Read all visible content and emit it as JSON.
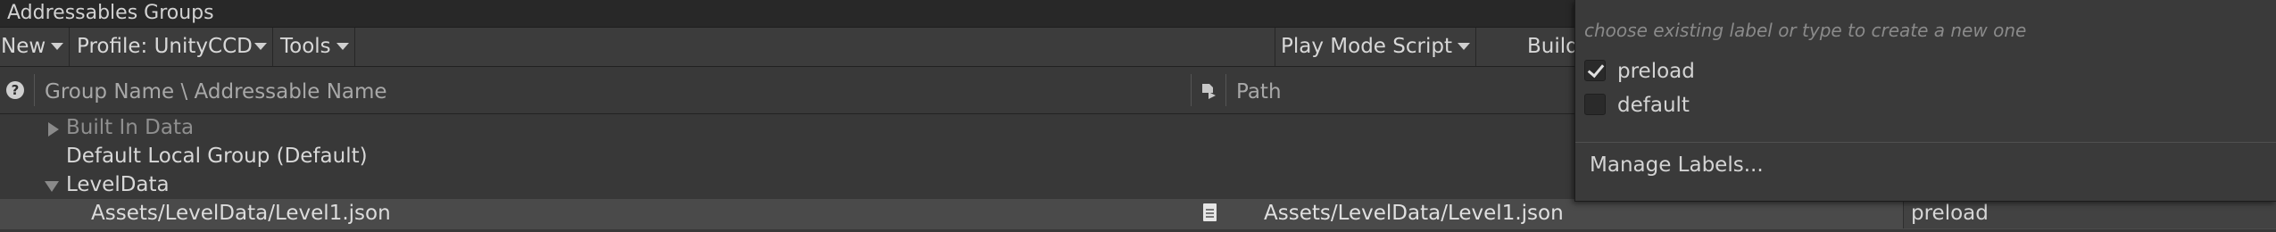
{
  "window": {
    "title": "Addressables Groups"
  },
  "toolbar": {
    "new_label": "New",
    "profile_label": "Profile: UnityCCD",
    "tools_label": "Tools",
    "play_mode_label": "Play Mode Script",
    "build_label": "Build"
  },
  "header": {
    "group_name": "Group Name \\ Addressable Name",
    "path": "Path"
  },
  "tree": {
    "rows": [
      {
        "label": "Built In Data"
      },
      {
        "label": "Default Local Group (Default)"
      },
      {
        "label": "LevelData"
      },
      {
        "label": "Assets/LevelData/Level1.json",
        "path": "Assets/LevelData/Level1.json",
        "labels": "preload"
      }
    ]
  },
  "label_popup": {
    "placeholder": "choose existing label or type to create a new one",
    "options": [
      {
        "label": "preload",
        "checked": true
      },
      {
        "label": "default",
        "checked": false
      }
    ],
    "manage_label": "Manage Labels..."
  },
  "colors": {
    "background": "#383838",
    "titlebar": "#282828",
    "selected_row": "#4a4a4a",
    "popup": "#3a3a3a"
  },
  "icons": [
    "help-icon",
    "caret-down-icon",
    "asset-type-icon",
    "expand-arrow-icon",
    "collapse-arrow-icon",
    "document-icon",
    "checkmark-icon"
  ]
}
